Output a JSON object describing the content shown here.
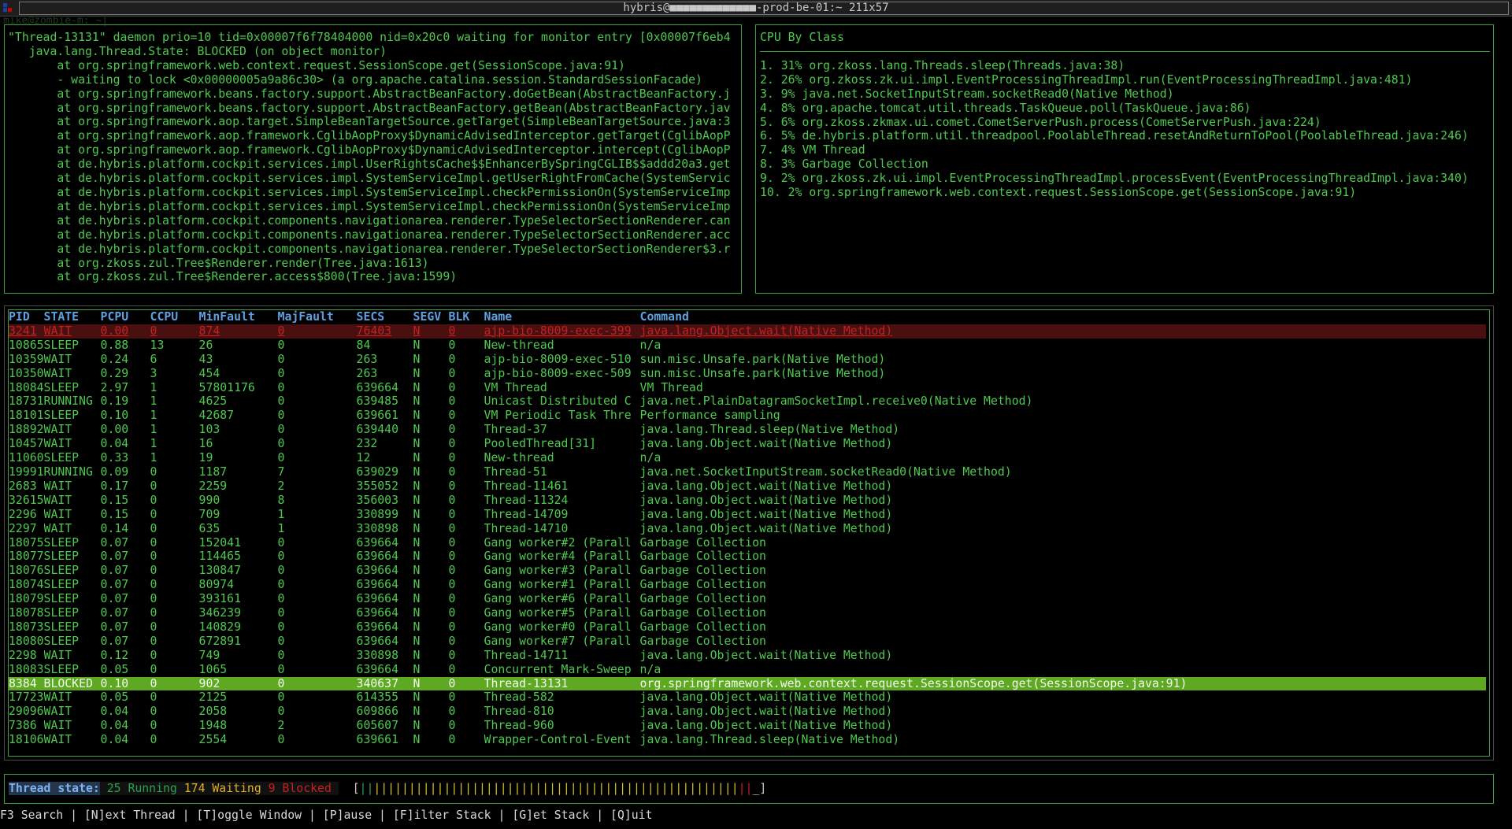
{
  "window": {
    "title": "hybris@■■■■■■■■■■■■■-prod-be-01:~ 211x57",
    "prompt_ghost": "mike@zombie-m: ~|"
  },
  "stack_trace": {
    "lines": [
      "\"Thread-13131\" daemon prio=10 tid=0x00007f6f78404000 nid=0x20c0 waiting for monitor entry [0x00007f6eb4",
      "   java.lang.Thread.State: BLOCKED (on object monitor)",
      "       at org.springframework.web.context.request.SessionScope.get(SessionScope.java:91)",
      "       - waiting to lock <0x00000005a9a86c30> (a org.apache.catalina.session.StandardSessionFacade)",
      "       at org.springframework.beans.factory.support.AbstractBeanFactory.doGetBean(AbstractBeanFactory.j",
      "       at org.springframework.beans.factory.support.AbstractBeanFactory.getBean(AbstractBeanFactory.jav",
      "       at org.springframework.aop.target.SimpleBeanTargetSource.getTarget(SimpleBeanTargetSource.java:3",
      "       at org.springframework.aop.framework.CglibAopProxy$DynamicAdvisedInterceptor.getTarget(CglibAopP",
      "       at org.springframework.aop.framework.CglibAopProxy$DynamicAdvisedInterceptor.intercept(CglibAopP",
      "       at de.hybris.platform.cockpit.services.impl.UserRightsCache$$EnhancerBySpringCGLIB$$addd20a3.get",
      "       at de.hybris.platform.cockpit.services.impl.SystemServiceImpl.getUserRightFromCache(SystemServic",
      "       at de.hybris.platform.cockpit.services.impl.SystemServiceImpl.checkPermissionOn(SystemServiceImp",
      "       at de.hybris.platform.cockpit.services.impl.SystemServiceImpl.checkPermissionOn(SystemServiceImp",
      "       at de.hybris.platform.cockpit.components.navigationarea.renderer.TypeSelectorSectionRenderer.can",
      "       at de.hybris.platform.cockpit.components.navigationarea.renderer.TypeSelectorSectionRenderer.acc",
      "       at de.hybris.platform.cockpit.components.navigationarea.renderer.TypeSelectorSectionRenderer$3.r",
      "       at org.zkoss.zul.Tree$Renderer.render(Tree.java:1613)",
      "       at org.zkoss.zul.Tree$Renderer.access$800(Tree.java:1599)"
    ]
  },
  "cpu_by_class": {
    "title": "CPU By Class",
    "items": [
      "1. 31% org.zkoss.lang.Threads.sleep(Threads.java:38)",
      "2. 26% org.zkoss.zk.ui.impl.EventProcessingThreadImpl.run(EventProcessingThreadImpl.java:481)",
      "3. 9% java.net.SocketInputStream.socketRead0(Native Method)",
      "4. 8% org.apache.tomcat.util.threads.TaskQueue.poll(TaskQueue.java:86)",
      "5. 6% org.zkoss.zkmax.ui.comet.CometServerPush.process(CometServerPush.java:224)",
      "6. 5% de.hybris.platform.util.threadpool.PoolableThread.resetAndReturnToPool(PoolableThread.java:246)",
      "7. 4% VM Thread",
      "8. 3% Garbage Collection",
      "9. 2% org.zkoss.zk.ui.impl.EventProcessingThreadImpl.processEvent(EventProcessingThreadImpl.java:340)",
      "10. 2% org.springframework.web.context.request.SessionScope.get(SessionScope.java:91)"
    ]
  },
  "threads": {
    "columns": [
      "PID",
      "STATE",
      "PCPU",
      "CCPU",
      "MinFault",
      "MajFault",
      "SECS",
      "SEGV",
      "BLK",
      "Name",
      "Command"
    ],
    "rows": [
      [
        "3241",
        "WAIT",
        "0.00",
        "0",
        "874",
        "0",
        "76403",
        "N",
        "0",
        "ajp-bio-8009-exec-399",
        "java.lang.Object.wait(Native Method)"
      ],
      [
        "10865",
        "SLEEP",
        "0.88",
        "13",
        "26",
        "0",
        "84",
        "N",
        "0",
        "New-thread",
        "n/a"
      ],
      [
        "10359",
        "WAIT",
        "0.24",
        "6",
        "43",
        "0",
        "263",
        "N",
        "0",
        "ajp-bio-8009-exec-510",
        "sun.misc.Unsafe.park(Native Method)"
      ],
      [
        "10350",
        "WAIT",
        "0.29",
        "3",
        "454",
        "0",
        "263",
        "N",
        "0",
        "ajp-bio-8009-exec-509",
        "sun.misc.Unsafe.park(Native Method)"
      ],
      [
        "18084",
        "SLEEP",
        "2.97",
        "1",
        "57801176",
        "0",
        "639664",
        "N",
        "0",
        "VM Thread",
        "VM Thread"
      ],
      [
        "18731",
        "RUNNING",
        "0.19",
        "1",
        "4625",
        "0",
        "639485",
        "N",
        "0",
        "Unicast Distributed C",
        "java.net.PlainDatagramSocketImpl.receive0(Native Method)"
      ],
      [
        "18101",
        "SLEEP",
        "0.10",
        "1",
        "42687",
        "0",
        "639661",
        "N",
        "0",
        "VM Periodic Task Thre",
        "Performance sampling"
      ],
      [
        "18892",
        "WAIT",
        "0.00",
        "1",
        "103",
        "0",
        "639440",
        "N",
        "0",
        "Thread-37",
        "java.lang.Thread.sleep(Native Method)"
      ],
      [
        "10457",
        "WAIT",
        "0.04",
        "1",
        "16",
        "0",
        "232",
        "N",
        "0",
        "PooledThread[31]",
        "java.lang.Object.wait(Native Method)"
      ],
      [
        "11060",
        "SLEEP",
        "0.33",
        "1",
        "19",
        "0",
        "12",
        "N",
        "0",
        "New-thread",
        "n/a"
      ],
      [
        "19991",
        "RUNNING",
        "0.09",
        "0",
        "1187",
        "7",
        "639029",
        "N",
        "0",
        "Thread-51",
        "java.net.SocketInputStream.socketRead0(Native Method)"
      ],
      [
        "2683",
        "WAIT",
        "0.17",
        "0",
        "2259",
        "2",
        "355052",
        "N",
        "0",
        "Thread-11461",
        "java.lang.Object.wait(Native Method)"
      ],
      [
        "32615",
        "WAIT",
        "0.15",
        "0",
        "990",
        "8",
        "356003",
        "N",
        "0",
        "Thread-11324",
        "java.lang.Object.wait(Native Method)"
      ],
      [
        "2296",
        "WAIT",
        "0.15",
        "0",
        "709",
        "1",
        "330899",
        "N",
        "0",
        "Thread-14709",
        "java.lang.Object.wait(Native Method)"
      ],
      [
        "2297",
        "WAIT",
        "0.14",
        "0",
        "635",
        "1",
        "330898",
        "N",
        "0",
        "Thread-14710",
        "java.lang.Object.wait(Native Method)"
      ],
      [
        "18075",
        "SLEEP",
        "0.07",
        "0",
        "152041",
        "0",
        "639664",
        "N",
        "0",
        "Gang worker#2 (Parall",
        "Garbage Collection"
      ],
      [
        "18077",
        "SLEEP",
        "0.07",
        "0",
        "114465",
        "0",
        "639664",
        "N",
        "0",
        "Gang worker#4 (Parall",
        "Garbage Collection"
      ],
      [
        "18076",
        "SLEEP",
        "0.07",
        "0",
        "130847",
        "0",
        "639664",
        "N",
        "0",
        "Gang worker#3 (Parall",
        "Garbage Collection"
      ],
      [
        "18074",
        "SLEEP",
        "0.07",
        "0",
        "80974",
        "0",
        "639664",
        "N",
        "0",
        "Gang worker#1 (Parall",
        "Garbage Collection"
      ],
      [
        "18079",
        "SLEEP",
        "0.07",
        "0",
        "393161",
        "0",
        "639664",
        "N",
        "0",
        "Gang worker#6 (Parall",
        "Garbage Collection"
      ],
      [
        "18078",
        "SLEEP",
        "0.07",
        "0",
        "346239",
        "0",
        "639664",
        "N",
        "0",
        "Gang worker#5 (Parall",
        "Garbage Collection"
      ],
      [
        "18073",
        "SLEEP",
        "0.07",
        "0",
        "140829",
        "0",
        "639664",
        "N",
        "0",
        "Gang worker#0 (Parall",
        "Garbage Collection"
      ],
      [
        "18080",
        "SLEEP",
        "0.07",
        "0",
        "672891",
        "0",
        "639664",
        "N",
        "0",
        "Gang worker#7 (Parall",
        "Garbage Collection"
      ],
      [
        "2298",
        "WAIT",
        "0.12",
        "0",
        "749",
        "0",
        "330898",
        "N",
        "0",
        "Thread-14711",
        "java.lang.Object.wait(Native Method)"
      ],
      [
        "18083",
        "SLEEP",
        "0.05",
        "0",
        "1065",
        "0",
        "639664",
        "N",
        "0",
        "Concurrent Mark-Sweep",
        "n/a"
      ],
      [
        "8384",
        "BLOCKED",
        "0.10",
        "0",
        "902",
        "0",
        "340637",
        "N",
        "0",
        "Thread-13131",
        "org.springframework.web.context.request.SessionScope.get(SessionScope.java:91)"
      ],
      [
        "17723",
        "WAIT",
        "0.05",
        "0",
        "2125",
        "0",
        "614355",
        "N",
        "0",
        "Thread-582",
        "java.lang.Object.wait(Native Method)"
      ],
      [
        "29096",
        "WAIT",
        "0.04",
        "0",
        "2058",
        "0",
        "609866",
        "N",
        "0",
        "Thread-810",
        "java.lang.Object.wait(Native Method)"
      ],
      [
        "7386",
        "WAIT",
        "0.04",
        "0",
        "1948",
        "2",
        "605607",
        "N",
        "0",
        "Thread-960",
        "java.lang.Object.wait(Native Method)"
      ],
      [
        "18106",
        "WAIT",
        "0.04",
        "0",
        "2554",
        "0",
        "639661",
        "N",
        "0",
        "Wrapper-Control-Event",
        "java.lang.Thread.sleep(Native Method)"
      ]
    ],
    "highlight_red_row": 0,
    "selected_row": 25
  },
  "thread_state": {
    "label": "Thread state:",
    "running": "25 Running",
    "waiting": "174 Waiting",
    "blocked": "9 Blocked",
    "bar_open": "[",
    "bar_running": "||",
    "bar_waiting": "||||||||||||||||||||||||||||||||||||||||||||||||||||",
    "bar_blocked": "||",
    "bar_close": "_]"
  },
  "footer": {
    "keys": "F3 Search | [N]ext Thread | [T]oggle Window | [P]ause | [F]ilter Stack | [G]et Stack | [Q]uit"
  },
  "colors": {
    "fg_green": "#4ec94e",
    "border_green": "#3fa23f",
    "header_blue": "#5fa0e0",
    "selected_bg": "#5fa821",
    "blocked_red": "#c42020",
    "waiting_yellow": "#e0b020"
  }
}
